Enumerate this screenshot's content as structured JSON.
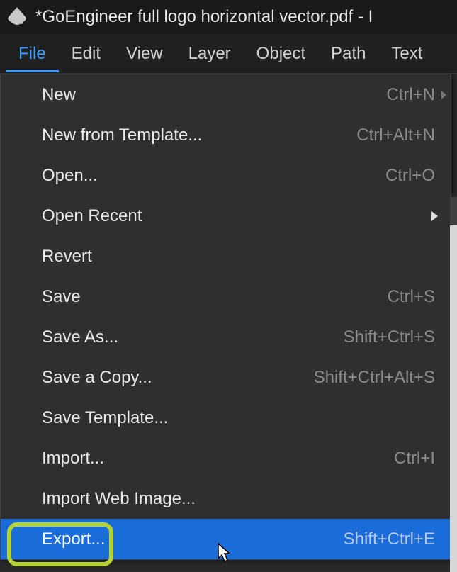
{
  "titlebar": {
    "text": "*GoEngineer full logo horizontal vector.pdf - I"
  },
  "menubar": {
    "items": [
      "File",
      "Edit",
      "View",
      "Layer",
      "Object",
      "Path",
      "Text"
    ],
    "active_index": 0
  },
  "file_menu": {
    "items": [
      {
        "label": "New",
        "shortcut": "Ctrl+N",
        "submenu": false,
        "side_arrow": true,
        "highlighted": false
      },
      {
        "label": "New from Template...",
        "shortcut": "Ctrl+Alt+N",
        "submenu": false,
        "highlighted": false
      },
      {
        "label": "Open...",
        "shortcut": "Ctrl+O",
        "submenu": false,
        "highlighted": false
      },
      {
        "label": "Open Recent",
        "shortcut": "",
        "submenu": true,
        "highlighted": false
      },
      {
        "label": "Revert",
        "shortcut": "",
        "submenu": false,
        "highlighted": false
      },
      {
        "label": "Save",
        "shortcut": "Ctrl+S",
        "submenu": false,
        "highlighted": false
      },
      {
        "label": "Save As...",
        "shortcut": "Shift+Ctrl+S",
        "submenu": false,
        "highlighted": false
      },
      {
        "label": "Save a Copy...",
        "shortcut": "Shift+Ctrl+Alt+S",
        "submenu": false,
        "highlighted": false
      },
      {
        "label": "Save Template...",
        "shortcut": "",
        "submenu": false,
        "highlighted": false
      },
      {
        "label": "Import...",
        "shortcut": "Ctrl+I",
        "submenu": false,
        "highlighted": false
      },
      {
        "label": "Import Web Image...",
        "shortcut": "",
        "submenu": false,
        "highlighted": false
      },
      {
        "label": "Export...",
        "shortcut": "Shift+Ctrl+E",
        "submenu": false,
        "highlighted": true
      }
    ]
  }
}
